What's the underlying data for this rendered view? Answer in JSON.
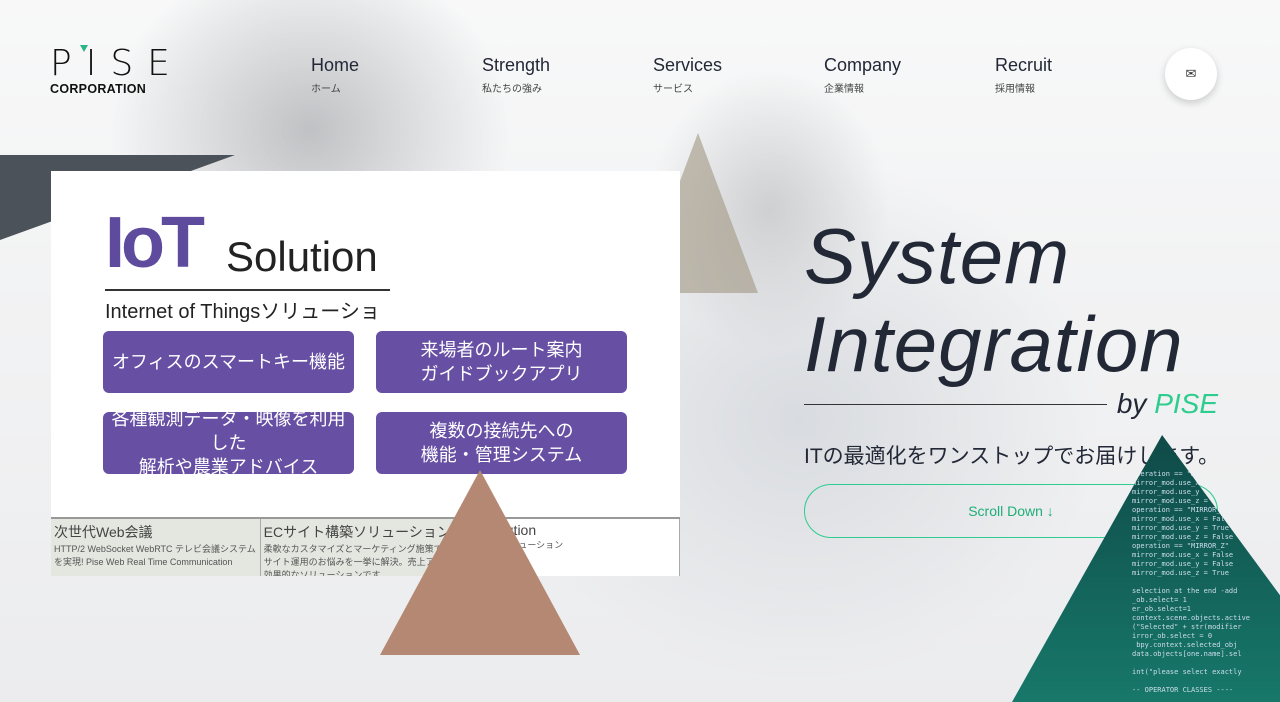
{
  "brand": {
    "logo_text": "PISE",
    "logo_sub": "CORPORATION"
  },
  "nav": [
    {
      "en": "Home",
      "ja": "ホーム"
    },
    {
      "en": "Strength",
      "ja": "私たちの強み"
    },
    {
      "en": "Services",
      "ja": "サービス"
    },
    {
      "en": "Company",
      "ja": "企業情報"
    },
    {
      "en": "Recruit",
      "ja": "採用情報"
    }
  ],
  "contact_icon": "mail-icon",
  "slide": {
    "title_iot": "IoT",
    "title_solution": "Solution",
    "subtitle": "Internet of Thingsソリューション",
    "boxes": [
      "オフィスのスマートキー機能",
      "来場者のルート案内\nガイドブックアプリ",
      "各種観測データ・映像を利用した\n解析や農業アドバイス",
      "複数の接続先への\n機能・管理システム"
    ],
    "thumbs": [
      {
        "title": "次世代Web会議",
        "text": "HTTP/2 WebSocket WebRTC テレビ会議システムを実現! Pise Web Real Time Communication"
      },
      {
        "title": "ECサイト構築ソリューション",
        "text": "柔軟なカスタマイズとマーケティング施策で ECサイト運用のお悩みを一挙に解決。売上アップに効果的なソリューションです。"
      },
      {
        "title": "T Solution",
        "text": "Thingsソリューション"
      }
    ]
  },
  "hero": {
    "line1": "System",
    "line2": "Integration",
    "by": "by ",
    "brand": "PISE",
    "catch": "ITの最適化をワンストップでお届けします。",
    "scroll": "Scroll Down ↓"
  },
  "accent": "#2ecc8e"
}
